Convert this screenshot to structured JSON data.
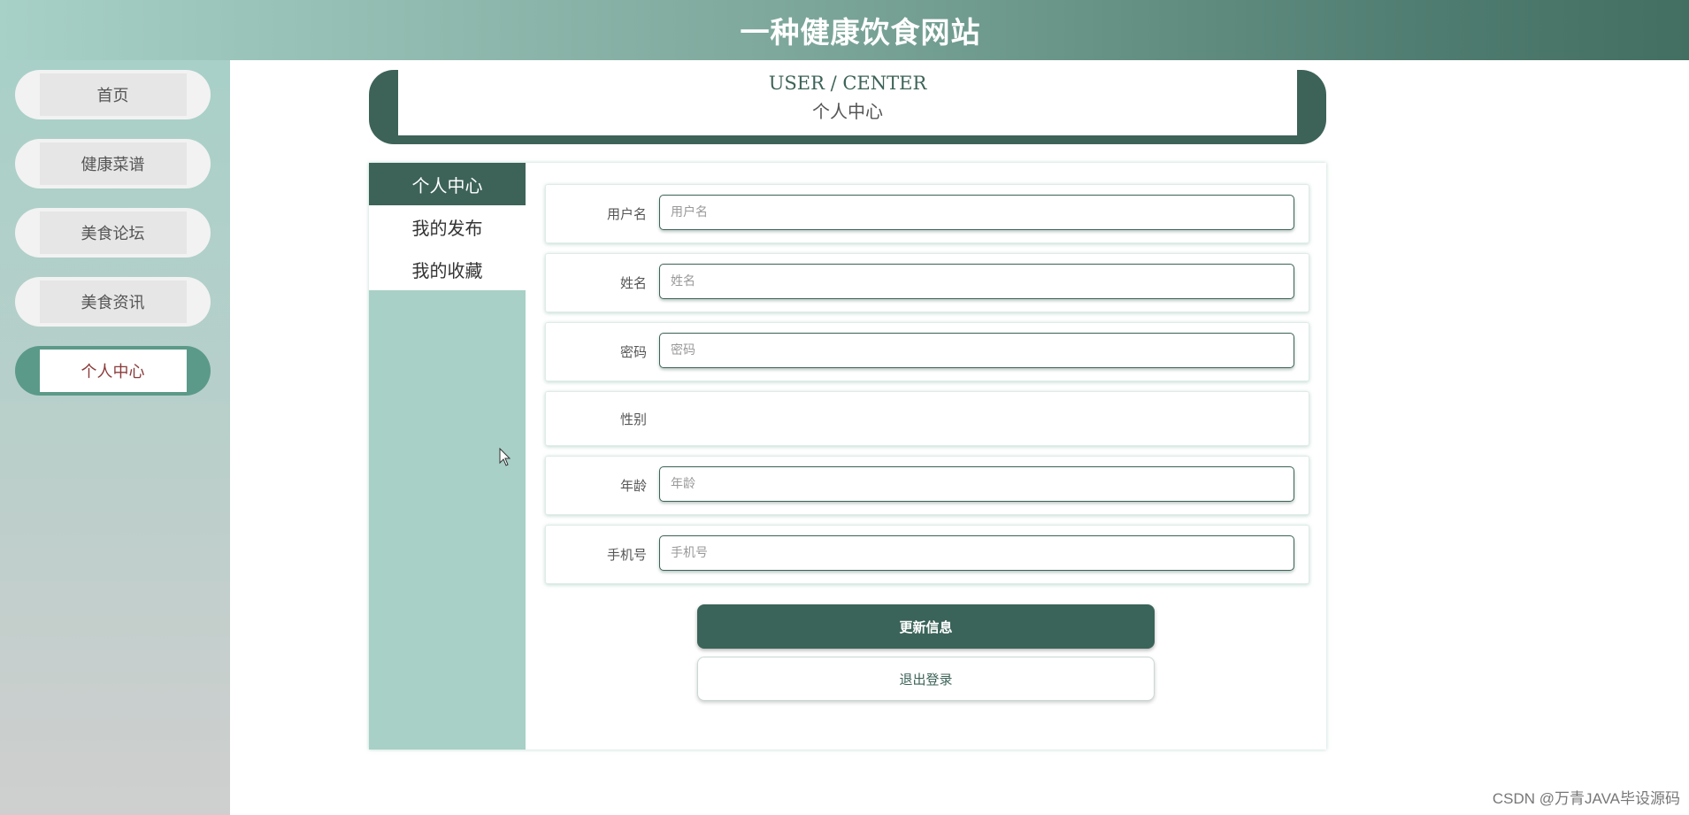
{
  "header": {
    "title": "一种健康饮食网站"
  },
  "sidebar": {
    "items": [
      {
        "label": "首页"
      },
      {
        "label": "健康菜谱"
      },
      {
        "label": "美食论坛"
      },
      {
        "label": "美食资讯"
      },
      {
        "label": "个人中心",
        "active": true
      }
    ]
  },
  "user_center": {
    "title_en": "USER / CENTER",
    "title_cn": "个人中心"
  },
  "subnav": {
    "items": [
      {
        "label": "个人中心",
        "active": true
      },
      {
        "label": "我的发布"
      },
      {
        "label": "我的收藏"
      }
    ]
  },
  "form": {
    "username": {
      "label": "用户名",
      "placeholder": "用户名",
      "value": ""
    },
    "name": {
      "label": "姓名",
      "placeholder": "姓名",
      "value": ""
    },
    "password": {
      "label": "密码",
      "placeholder": "密码",
      "value": ""
    },
    "gender": {
      "label": "性别"
    },
    "age": {
      "label": "年龄",
      "placeholder": "年龄",
      "value": ""
    },
    "phone": {
      "label": "手机号",
      "placeholder": "手机号",
      "value": ""
    }
  },
  "buttons": {
    "update": "更新信息",
    "logout": "退出登录"
  },
  "watermark": "CSDN @万青JAVA毕设源码",
  "colors": {
    "primary": "#3d6358",
    "accent_light": "#a8d0c6",
    "active_nav": "#5b9a88"
  }
}
